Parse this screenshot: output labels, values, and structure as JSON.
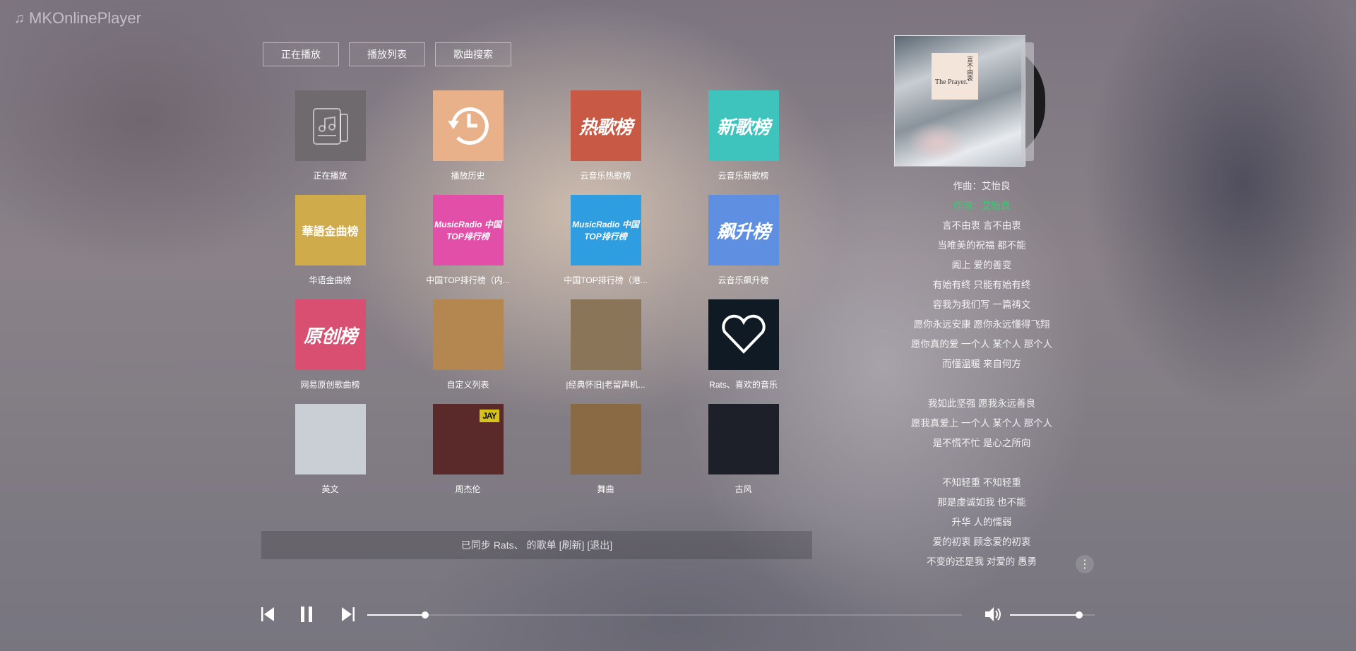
{
  "app": {
    "title": "MKOnlinePlayer"
  },
  "tabs": [
    {
      "label": "正在播放"
    },
    {
      "label": "播放列表"
    },
    {
      "label": "歌曲搜索"
    }
  ],
  "playlists": [
    {
      "title": "正在播放",
      "cover_text": "",
      "color": "#6f6a6e",
      "icon": "music-note-list-icon"
    },
    {
      "title": "播放历史",
      "cover_text": "",
      "color": "#e9b18a",
      "icon": "history-clock-icon"
    },
    {
      "title": "云音乐热歌榜",
      "cover_text": "热歌榜",
      "color": "#c85a45"
    },
    {
      "title": "云音乐新歌榜",
      "cover_text": "新歌榜",
      "color": "#3fc3bd"
    },
    {
      "title": "华语金曲榜",
      "cover_text": "華語金曲榜",
      "color": "#cfab4c"
    },
    {
      "title": "中国TOP排行榜（内...",
      "cover_text": "MusicRadio 中国TOP排行榜",
      "color": "#e24fa8"
    },
    {
      "title": "中国TOP排行榜（港...",
      "cover_text": "MusicRadio 中国TOP排行榜",
      "color": "#2f9ee0"
    },
    {
      "title": "云音乐飙升榜",
      "cover_text": "飙升榜",
      "color": "#5f8fe0"
    },
    {
      "title": "网易原创歌曲榜",
      "cover_text": "原创榜",
      "color": "#d94f72"
    },
    {
      "title": "自定义列表",
      "cover_text": "",
      "color": "#b3874f"
    },
    {
      "title": "|经典怀旧|老留声机...",
      "cover_text": "",
      "color": "#8a7558"
    },
    {
      "title": "Rats、喜欢的音乐",
      "cover_text": "",
      "color": "#0f1a24",
      "icon": "heart-icon"
    },
    {
      "title": "英文",
      "cover_text": "",
      "color": "#c9cfd4"
    },
    {
      "title": "周杰伦",
      "cover_text": "JAY",
      "color": "#5a2a2a"
    },
    {
      "title": "舞曲",
      "cover_text": "",
      "color": "#8a6a45"
    },
    {
      "title": "古风",
      "cover_text": "",
      "color": "#1d2028"
    }
  ],
  "sync": {
    "prefix": "已同步",
    "user": "Rats、",
    "suffix": "的歌单",
    "refresh": "[刷新]",
    "logout": "[退出]"
  },
  "album": {
    "title": "The Prayer.",
    "subtitle": "言不由衷"
  },
  "lyrics": [
    {
      "text": "作曲：艾怡良"
    },
    {
      "text": "作词：艾怡良",
      "active": true
    },
    {
      "text": "言不由衷 言不由衷"
    },
    {
      "text": "当唯美的祝福 都不能"
    },
    {
      "text": "阖上 爱的善变"
    },
    {
      "text": "有始有终 只能有始有终"
    },
    {
      "text": "容我为我们写 一篇祷文"
    },
    {
      "text": "愿你永远安康 愿你永远懂得飞翔"
    },
    {
      "text": "愿你真的爱 一个人 某个人 那个人"
    },
    {
      "text": "而懂温暖 来自何方"
    },
    {
      "text": ""
    },
    {
      "text": "我如此坚强 愿我永远善良"
    },
    {
      "text": "愿我真爱上 一个人 某个人 那个人"
    },
    {
      "text": "是不慌不忙 是心之所向"
    },
    {
      "text": ""
    },
    {
      "text": "不知轻重 不知轻重"
    },
    {
      "text": "那是虔诚如我 也不能"
    },
    {
      "text": "升华 人的懦弱"
    },
    {
      "text": "爱的初衷 顾念爱的初衷"
    },
    {
      "text": "不变的还是我 对爱的 愚勇"
    }
  ],
  "player": {
    "progress": 0.097,
    "volume": 0.82
  },
  "colors": {
    "accent": "#2dd36f"
  }
}
